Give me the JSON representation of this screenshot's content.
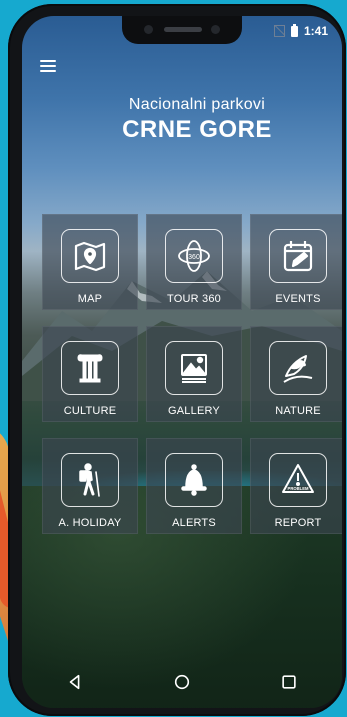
{
  "status_bar": {
    "time": "1:41"
  },
  "brand": {
    "subtitle": "Nacionalni parkovi",
    "title": "CRNE GORE"
  },
  "menu": {
    "tiles": [
      {
        "label": "MAP",
        "icon": "map-icon"
      },
      {
        "label": "TOUR 360",
        "icon": "tour360-icon"
      },
      {
        "label": "EVENTS",
        "icon": "calendar-icon"
      },
      {
        "label": "CULTURE",
        "icon": "column-icon"
      },
      {
        "label": "GALLERY",
        "icon": "image-icon"
      },
      {
        "label": "NATURE",
        "icon": "bird-icon"
      },
      {
        "label": "A. HOLIDAY",
        "icon": "hiker-icon"
      },
      {
        "label": "ALERTS",
        "icon": "bell-icon"
      },
      {
        "label": "REPORT",
        "icon": "warning-icon"
      }
    ],
    "tour_badge": "360",
    "report_badge": "PROBLEM"
  },
  "nav": {
    "back": "back-icon",
    "home": "home-icon",
    "recents": "recents-icon"
  }
}
